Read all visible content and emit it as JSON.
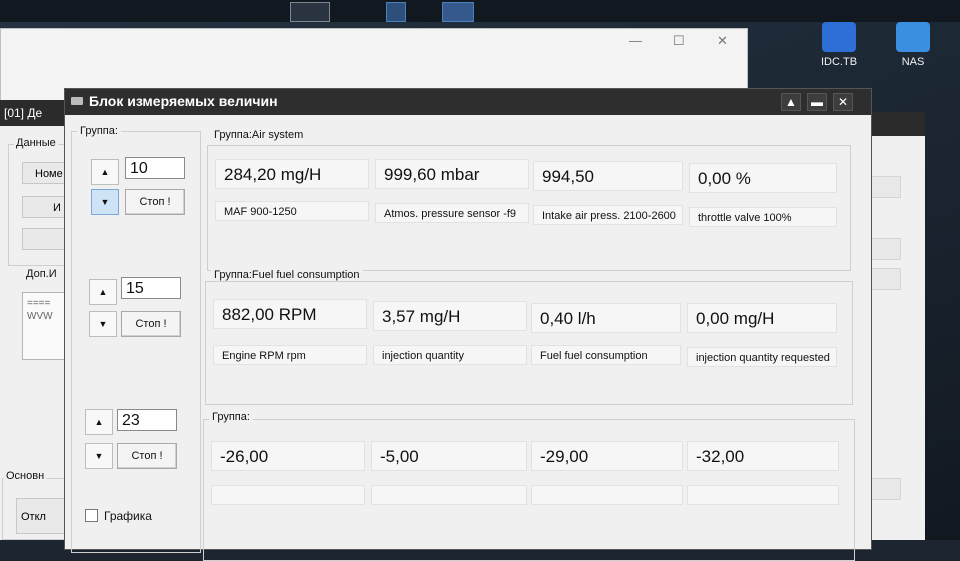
{
  "desktop": {
    "icons": [
      {
        "label": "IDC.TB",
        "icon": "idc-app-icon",
        "color": "#2d6fd6"
      },
      {
        "label": "NAS",
        "icon": "nas-folder-icon",
        "color": "#3a8fe0"
      }
    ]
  },
  "background_window": {
    "left_title": "[01] Де",
    "left_labels": {
      "data_group": "Данные",
      "btn1": "Номе",
      "btn2": "И",
      "extra_info": "Доп.И",
      "memo": "====\nWVW",
      "main_group": "Основн",
      "bottom_btn": "Откл"
    }
  },
  "window": {
    "title": "Блок измеряемых величин",
    "controls": {
      "minimize": "▲",
      "restore": "▬",
      "close": "✕"
    },
    "groups_label": "Группа:",
    "group_rows": [
      {
        "number": "10",
        "stop_label": "Стоп !",
        "up": "▲",
        "down": "▼"
      },
      {
        "number": "15",
        "stop_label": "Стоп !",
        "up": "▲",
        "down": "▼"
      },
      {
        "number": "23",
        "stop_label": "Стоп !",
        "up": "▲",
        "down": "▼"
      }
    ],
    "graph_checkbox": {
      "label": "Графика",
      "checked": false
    },
    "groups": [
      {
        "title": "Группа:Air system",
        "values": [
          "284,20 mg/H",
          "999,60 mbar",
          "994,50",
          "0,00 %"
        ],
        "descriptions": [
          "MAF 900-1250",
          "Atmos. pressure sensor  -f9",
          "Intake air press. 2100-2600",
          "throttle valve 100%"
        ]
      },
      {
        "title": "Группа:Fuel fuel consumption",
        "values": [
          "882,00 RPM",
          "3,57 mg/H",
          "0,40 l/h",
          "0,00 mg/H"
        ],
        "descriptions": [
          "Engine RPM rpm",
          "injection quantity",
          "Fuel fuel consumption",
          "injection quantity requested"
        ]
      },
      {
        "title": "Группа:",
        "values": [
          "-26,00",
          "-5,00",
          "-29,00",
          "-32,00"
        ],
        "descriptions": [
          "",
          "",
          "",
          ""
        ]
      }
    ]
  }
}
